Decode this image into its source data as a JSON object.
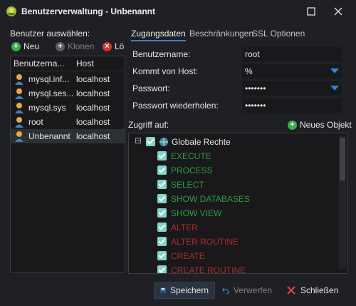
{
  "window": {
    "title": "Benutzerverwaltung - Unbenannt"
  },
  "users": {
    "section_label": "Benutzer auswählen:",
    "toolbar": {
      "new_label": "Neu",
      "clone_label": "Klonen",
      "delete_label": "Lö"
    },
    "columns": {
      "name": "Benutzerna...",
      "host": "Host"
    },
    "rows": [
      {
        "name": "mysql.inf...",
        "host": "localhost"
      },
      {
        "name": "mysql.ses...",
        "host": "localhost"
      },
      {
        "name": "mysql.sys",
        "host": "localhost"
      },
      {
        "name": "root",
        "host": "localhost"
      },
      {
        "name": "Unbenannt",
        "host": "localhost"
      }
    ]
  },
  "tabs": [
    "Zugangsdaten",
    "Beschränkungen",
    "SSL Optionen"
  ],
  "form": {
    "username_label": "Benutzername:",
    "username_value": "root",
    "host_label": "Kommt von Host:",
    "host_value": "%",
    "password_label": "Passwort:",
    "password_value": "•••••••",
    "repeat_label": "Passwort wiederholen:",
    "repeat_value": "•••••••"
  },
  "access": {
    "label": "Zugriff auf:",
    "new_object_label": "Neues Objekt",
    "root_label": "Globale Rechte",
    "collapse_symbol": "⊟",
    "privileges": [
      {
        "name": "EXECUTE",
        "color": "#2e9e3a"
      },
      {
        "name": "PROCESS",
        "color": "#2e9e3a"
      },
      {
        "name": "SELECT",
        "color": "#2e9e3a"
      },
      {
        "name": "SHOW DATABASES",
        "color": "#2e9e3a"
      },
      {
        "name": "SHOW VIEW",
        "color": "#2e9e3a"
      },
      {
        "name": "ALTER",
        "color": "#b02a2a"
      },
      {
        "name": "ALTER ROUTINE",
        "color": "#b02a2a"
      },
      {
        "name": "CREATE",
        "color": "#b02a2a"
      },
      {
        "name": "CREATE ROUTINE",
        "color": "#b02a2a"
      }
    ]
  },
  "buttons": {
    "save": "Speichern",
    "discard": "Verwerfen",
    "close": "Schließen"
  }
}
